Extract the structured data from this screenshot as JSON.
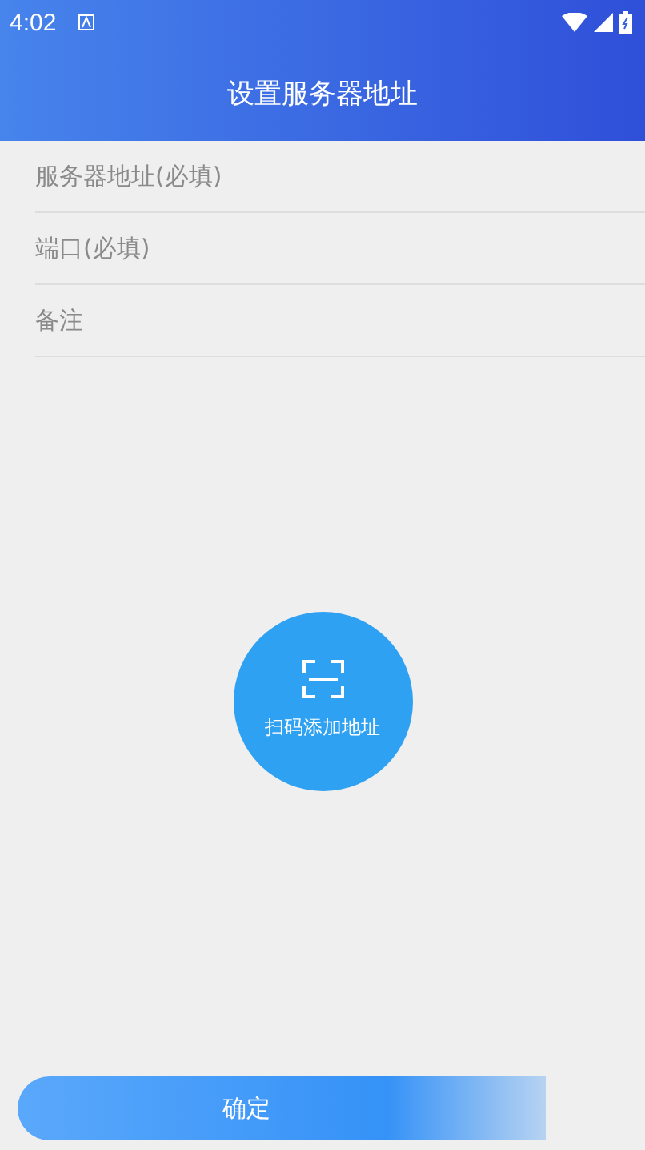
{
  "status_bar": {
    "time": "4:02"
  },
  "header": {
    "title": "设置服务器地址"
  },
  "fields": [
    {
      "placeholder": "服务器地址(必填)"
    },
    {
      "placeholder": "端口(必填)"
    },
    {
      "placeholder": "备注"
    }
  ],
  "scan_button": {
    "label": "扫码添加地址"
  },
  "confirm_button": {
    "label": "确定"
  }
}
